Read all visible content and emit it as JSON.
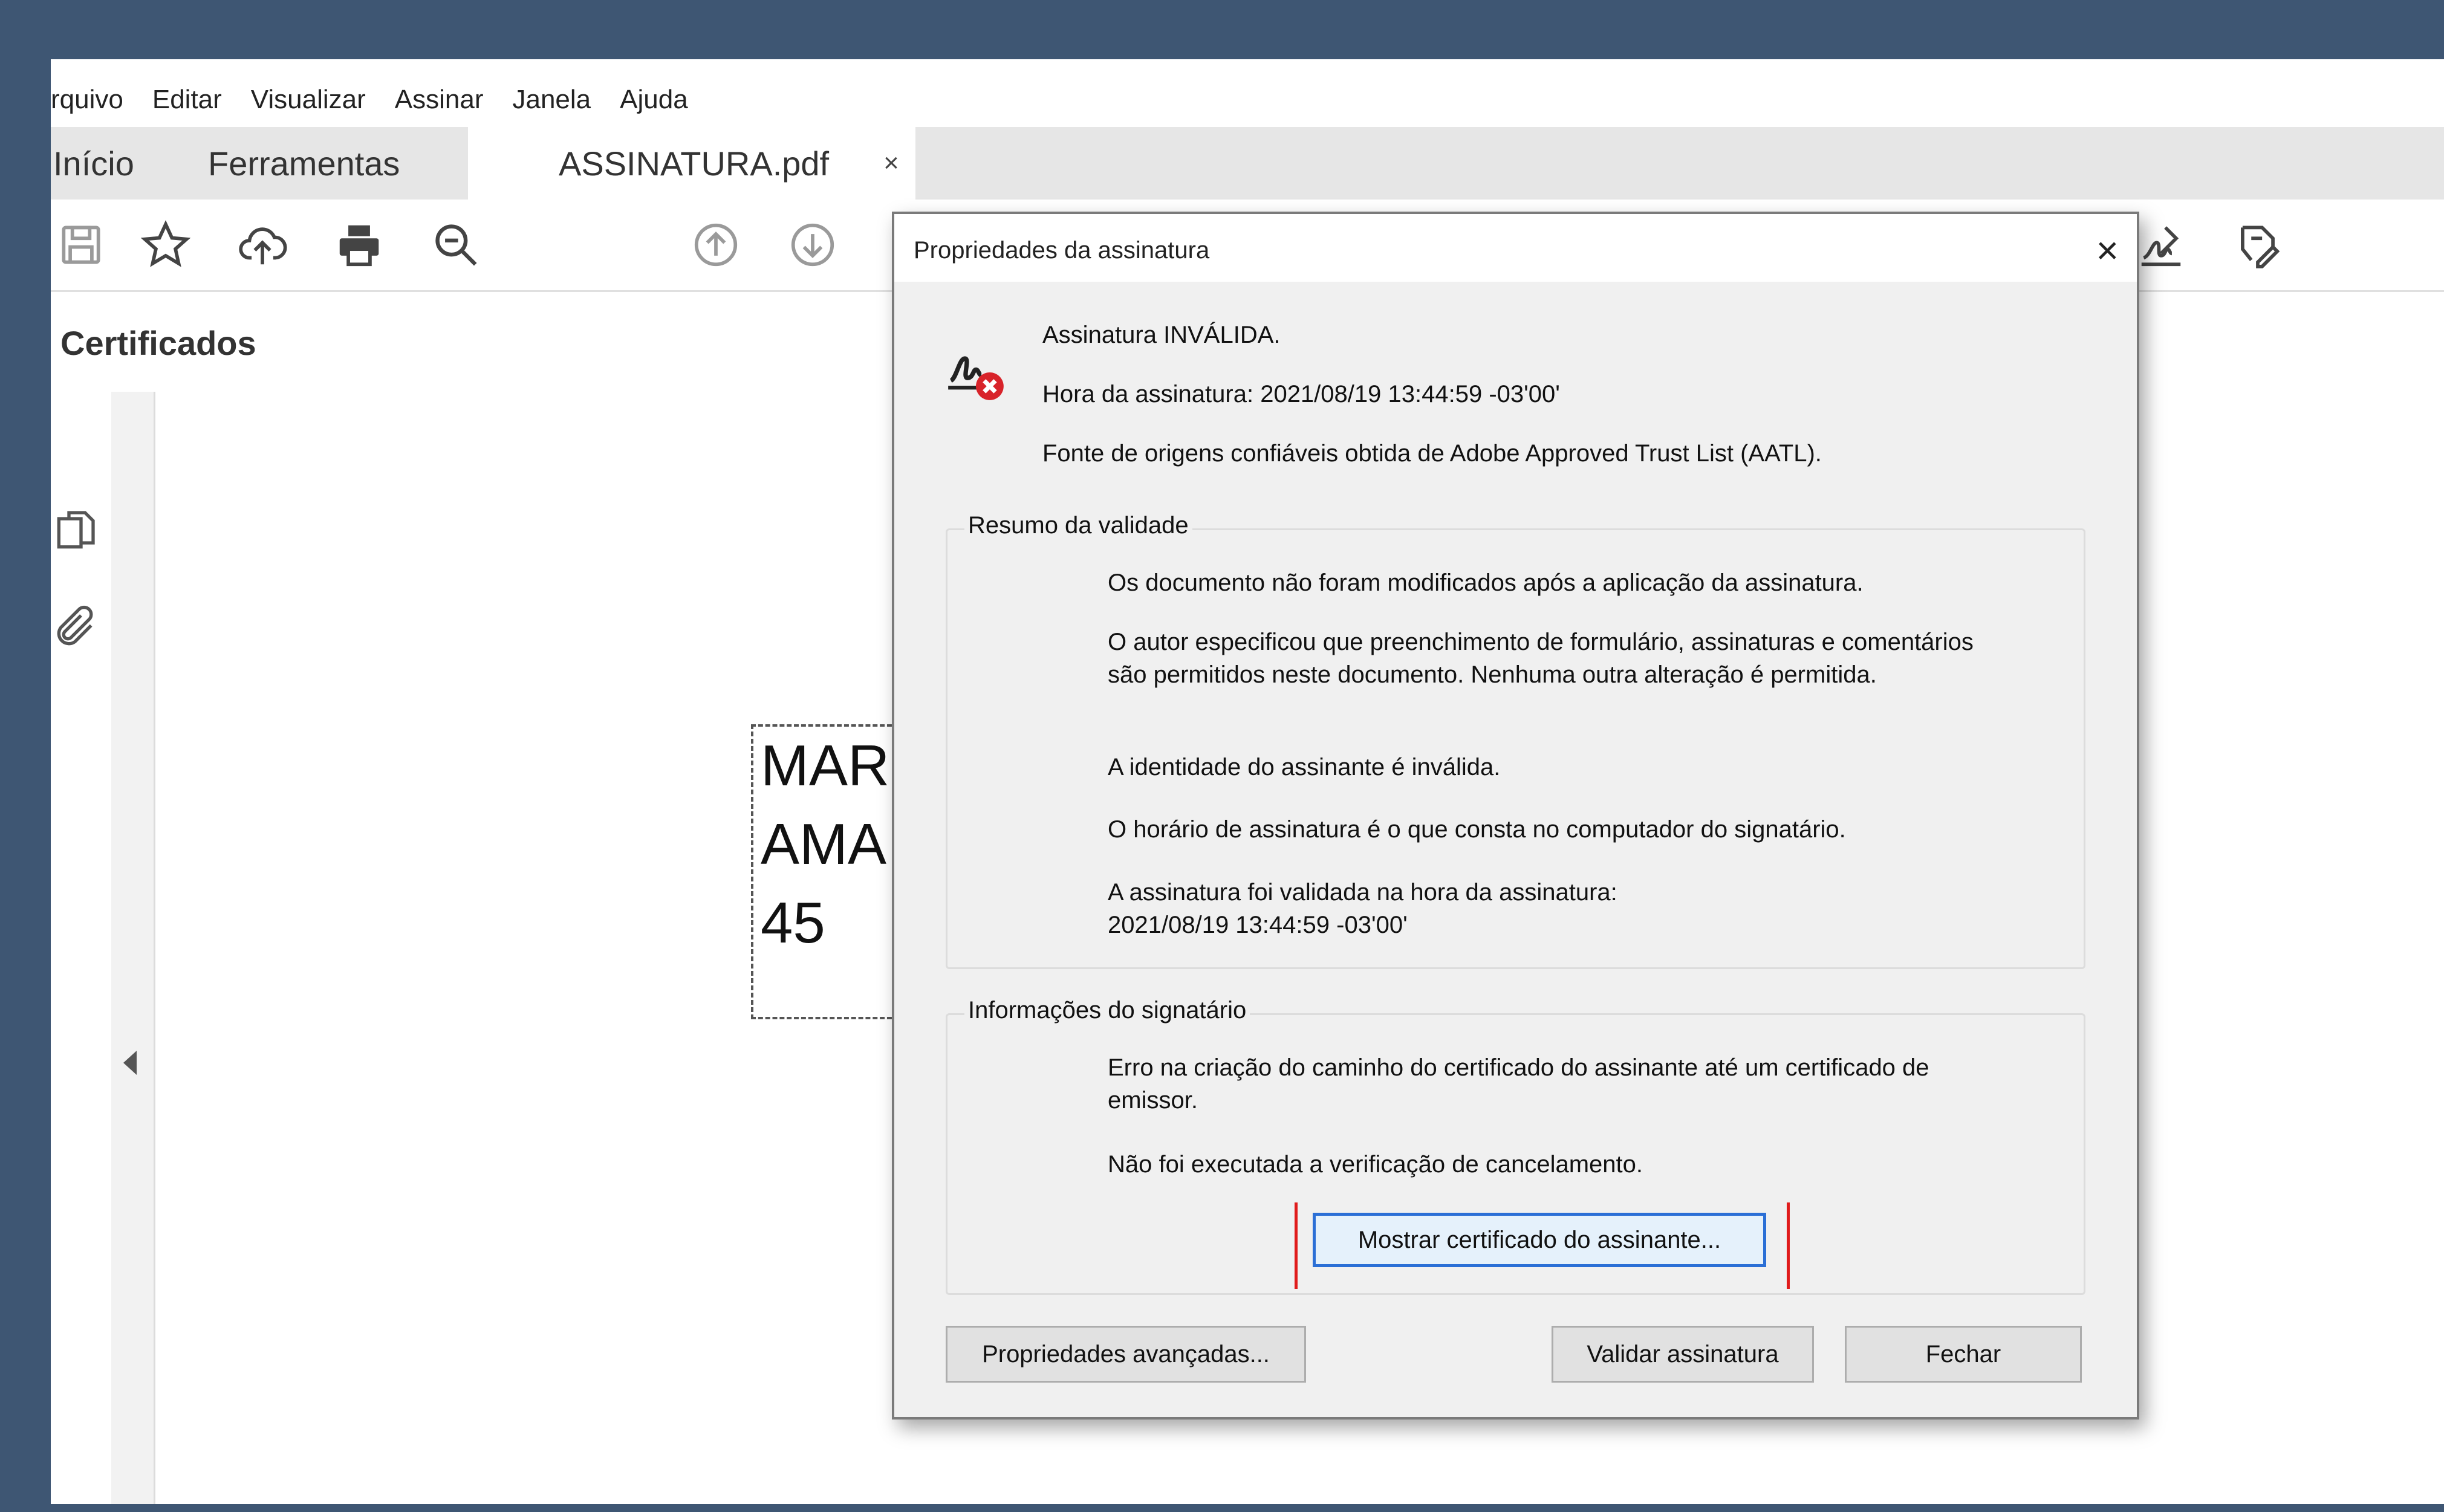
{
  "menubar": {
    "items": [
      "rquivo",
      "Editar",
      "Visualizar",
      "Assinar",
      "Janela",
      "Ajuda"
    ]
  },
  "tabs": {
    "home": "Início",
    "tools": "Ferramentas",
    "document": "ASSINATURA.pdf",
    "close_symbol": "×"
  },
  "toolbar": {
    "icons": [
      "save-icon",
      "star-icon",
      "cloud-upload-icon",
      "print-icon",
      "zoom-search-icon",
      "page-up-icon",
      "page-down-icon",
      "sign-icon",
      "fill-sign-icon"
    ]
  },
  "panel": {
    "title": "Certificados",
    "rail_icons": [
      "pages-icon",
      "attachment-icon"
    ]
  },
  "document": {
    "signature_field_lines": [
      "MAR",
      "AMA",
      "45"
    ]
  },
  "dialog": {
    "title": "Propriedades da assinatura",
    "close_symbol": "×",
    "status": {
      "line1": "Assinatura INVÁLIDA.",
      "line2": "Hora da assinatura:  2021/08/19 13:44:59 -03'00'",
      "line3": "Fonte de origens confiáveis obtida de Adobe Approved Trust List (AATL)."
    },
    "validity": {
      "legend": "Resumo da validade",
      "items": [
        "Os documento não foram modificados após a aplicação da assinatura.",
        "O autor especificou que preenchimento de formulário, assinaturas e comentários são permitidos neste documento. Nenhuma outra alteração é permitida.",
        "A identidade do assinante é inválida.",
        "O horário de assinatura é o que consta no computador do signatário.",
        "A assinatura foi validada na hora da assinatura:\n2021/08/19 13:44:59 -03'00'"
      ]
    },
    "signer": {
      "legend": "Informações do signatário",
      "items": [
        "Erro na criação do caminho do certificado do assinante até um certificado de emissor.",
        "Não foi executada a verificação de cancelamento."
      ],
      "show_cert_button": "Mostrar certificado do assinante..."
    },
    "buttons": {
      "advanced": "Propriedades avançadas...",
      "validate": "Validar assinatura",
      "close": "Fechar"
    },
    "colors": {
      "error_red": "#d8232a",
      "focus_blue": "#2b6fd6",
      "annotation_red": "#e01b1b"
    }
  }
}
